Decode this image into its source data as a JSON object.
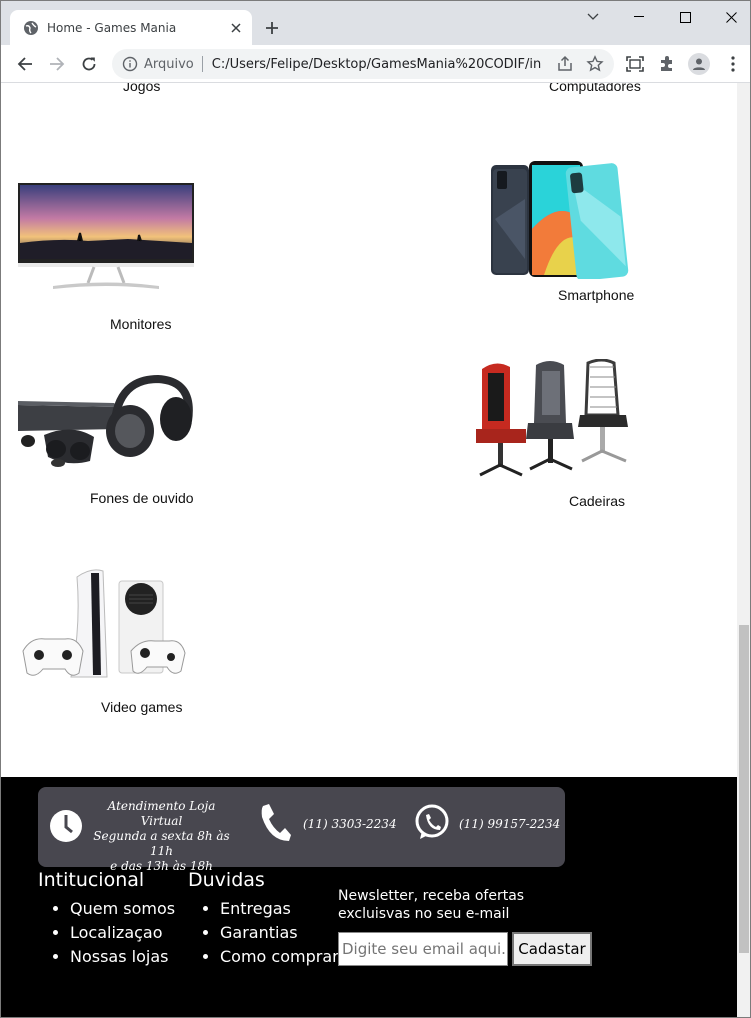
{
  "browser": {
    "tab_title": "Home - Games Mania",
    "address_scheme_label": "Arquivo",
    "address_url": "C:/Users/Felipe/Desktop/GamesMania%20CODIF/in..."
  },
  "categories": {
    "top_left_partial": "Jogos",
    "top_right_partial": "Computadores",
    "monitores": "Monitores",
    "smartphone": "Smartphone",
    "fones": "Fones de ouvido",
    "cadeiras": "Cadeiras",
    "videogames": "Video games"
  },
  "contact": {
    "hours_title": "Atendimento Loja Virtual",
    "hours_line1": "Segunda a sexta 8h às 11h",
    "hours_line2": "e das 13h às 18h",
    "phone": "(11) 3303-2234",
    "whatsapp": "(11) 99157-2234"
  },
  "footer": {
    "institucional": {
      "title": "Intitucional",
      "items": [
        "Quem somos",
        "Localizaçao",
        "Nossas lojas"
      ]
    },
    "duvidas": {
      "title": "Duvidas",
      "items": [
        "Entregas",
        "Garantias",
        "Como comprar"
      ]
    },
    "newsletter": {
      "text": "Newsletter, receba ofertas excluisvas no seu e-mail",
      "placeholder": "Digite seu email aqui...",
      "button": "Cadastar"
    }
  },
  "colors": {
    "footer_bg": "#000000",
    "contact_bar_bg": "#48474f",
    "tabstrip_bg": "#dee1e6"
  }
}
